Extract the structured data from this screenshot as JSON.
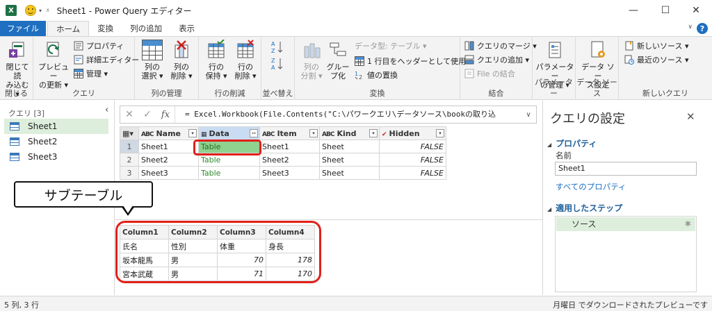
{
  "window": {
    "title": "Sheet1 - Power Query エディター",
    "app_icon": "X"
  },
  "tabs": [
    "ファイル",
    "ホーム",
    "変換",
    "列の追加",
    "表示"
  ],
  "ribbon": {
    "close": {
      "btn1": "閉じて読",
      "btn2": "み込む ▾",
      "label": "閉じる"
    },
    "query": {
      "preview1": "プレビュー",
      "preview2": "の更新 ▾",
      "props": "プロパティ",
      "adv_editor": "詳細エディター",
      "manage": "管理 ▾",
      "label": "クエリ"
    },
    "cols": {
      "sel1": "列の",
      "sel2": "選択 ▾",
      "del1": "列の",
      "del2": "削除 ▾",
      "label": "列の管理"
    },
    "rows": {
      "keep1": "行の",
      "keep2": "保持 ▾",
      "del1": "行の",
      "del2": "削除 ▾",
      "label": "行の削減"
    },
    "sort": {
      "label": "並べ替え"
    },
    "transform": {
      "split1": "列の",
      "split2": "分割 ▾",
      "group1": "グルー",
      "group2": "プ化",
      "dtype": "データ型: テーブル ▾",
      "header": "1 行目をヘッダーとして使用 ▾",
      "replace": "値の置換",
      "label": "変換"
    },
    "combine": {
      "merge": "クエリのマージ ▾",
      "append": "クエリの追加 ▾",
      "files": "File の結合",
      "label": "結合"
    },
    "params": {
      "manage1": "パラメーター",
      "manage2": "の管理 ▾",
      "label": "パラメーター"
    },
    "datasource": {
      "set1": "データ ソー",
      "set2": "ス設定",
      "label": "データ ソース"
    },
    "newquery": {
      "new": "新しいソース ▾",
      "recent": "最近のソース ▾",
      "label": "新しいクエリ"
    }
  },
  "formula": {
    "fx": "fx",
    "text": "= Excel.Workbook(File.Contents(\"C:\\パワークエリ\\データソース\\bookの取り込"
  },
  "queries": {
    "header": "クエリ [3]",
    "items": [
      "Sheet1",
      "Sheet2",
      "Sheet3"
    ]
  },
  "grid": {
    "columns": [
      {
        "type": "ABC",
        "name": "Name"
      },
      {
        "type": "▦",
        "name": "Data"
      },
      {
        "type": "ABC",
        "name": "Item"
      },
      {
        "type": "ABC",
        "name": "Kind"
      },
      {
        "type": "✔",
        "name": "Hidden"
      }
    ],
    "rows": [
      {
        "num": "1",
        "name": "Sheet1",
        "data": "Table",
        "item": "Sheet1",
        "kind": "Sheet",
        "hidden": "FALSE"
      },
      {
        "num": "2",
        "name": "Sheet2",
        "data": "Table",
        "item": "Sheet2",
        "kind": "Sheet",
        "hidden": "FALSE"
      },
      {
        "num": "3",
        "name": "Sheet3",
        "data": "Table",
        "item": "Sheet3",
        "kind": "Sheet",
        "hidden": "FALSE"
      }
    ]
  },
  "callout": "サブテーブル",
  "subtable": {
    "columns": [
      "Column1",
      "Column2",
      "Column3",
      "Column4"
    ],
    "rows": [
      [
        "氏名",
        "性別",
        "体重",
        "身長"
      ],
      [
        "坂本龍馬",
        "男",
        "70",
        "178"
      ],
      [
        "宮本武蔵",
        "男",
        "71",
        "170"
      ]
    ]
  },
  "settings": {
    "title": "クエリの設定",
    "properties": "プロパティ",
    "name_label": "名前",
    "name_value": "Sheet1",
    "all_props": "すべてのプロパティ",
    "applied_steps": "適用したステップ",
    "steps": [
      "ソース"
    ]
  },
  "status": {
    "left": "5 列, 3 行",
    "right": "月曜日 でダウンロードされたプレビューです"
  },
  "colors": {
    "accent": "#1e6fc0",
    "highlight": "#e0201a",
    "table_link": "#2b8a2b"
  }
}
